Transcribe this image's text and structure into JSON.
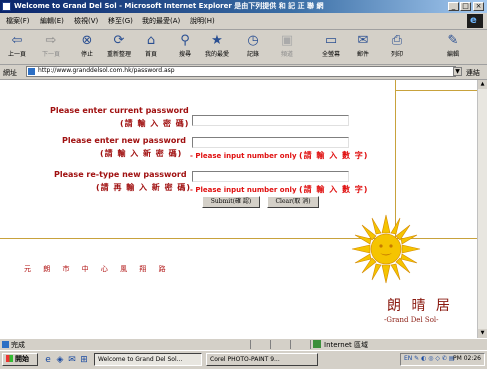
{
  "window": {
    "title": "Welcome to Grand Del Sol - Microsoft Internet Explorer 是由下列提供 和 記 正 聯 網",
    "controls": [
      "_",
      "□",
      "×"
    ]
  },
  "menu": [
    "檔案(F)",
    "編輯(E)",
    "檢視(V)",
    "移至(G)",
    "我的最愛(A)",
    "說明(H)"
  ],
  "toolbar": [
    {
      "label": "上一頁",
      "icon": "back-arrow-icon",
      "glyph": "⇦"
    },
    {
      "label": "下一頁",
      "icon": "forward-arrow-icon",
      "glyph": "⇨"
    },
    {
      "label": "停止",
      "icon": "stop-icon",
      "glyph": "⊗"
    },
    {
      "label": "重新整理",
      "icon": "refresh-icon",
      "glyph": "⟳"
    },
    {
      "label": "首頁",
      "icon": "home-icon",
      "glyph": "⌂"
    },
    {
      "label": "搜尋",
      "icon": "search-icon",
      "glyph": "⚲"
    },
    {
      "label": "我的最愛",
      "icon": "favorites-icon",
      "glyph": "★"
    },
    {
      "label": "記錄",
      "icon": "history-icon",
      "glyph": "◷"
    },
    {
      "label": "頻道",
      "icon": "channels-icon",
      "glyph": "▣"
    },
    {
      "label": "全螢幕",
      "icon": "fullscreen-icon",
      "glyph": "▭"
    },
    {
      "label": "郵件",
      "icon": "mail-icon",
      "glyph": "✉"
    },
    {
      "label": "列印",
      "icon": "print-icon",
      "glyph": "⎙"
    },
    {
      "label": "編輯",
      "icon": "edit-icon",
      "glyph": "✎"
    }
  ],
  "address": {
    "label": "網址",
    "url": "http://www.granddelsol.com.hk/password.asp",
    "go": "連結"
  },
  "form": {
    "current_label": "Please enter current password",
    "current_label_zh": "(請 輸 入 密 碼)",
    "new_label": "Please enter new password",
    "new_label_zh": "(請 輸 入 新 密 碼)",
    "new_note": "Please input number only",
    "new_note_zh": "(請 輸 入 數 字)",
    "retype_label": "Please re-type new password",
    "retype_label_zh": "(請 再 輸 入 新 密 碼)",
    "retype_note": "Please input number only",
    "retype_note_zh": "(請 輸 入 數 字)",
    "submit": "Submit(確 認)",
    "clear": "Clear(取 消)",
    "note_prefix": "-"
  },
  "footer": {
    "links": "元 朗 市 中 心 風 翔 路"
  },
  "brand": {
    "name_zh": "朗 晴 居",
    "name_en": "-Grand Del Sol-"
  },
  "status": {
    "text": "完成",
    "zone": "Internet 區域"
  },
  "taskbar": {
    "start": "開始",
    "quicklaunch": [
      "e",
      "◈",
      "✉",
      "⊞"
    ],
    "tasks": [
      "Welcome to Grand Del Sol...",
      "Corel PHOTO-PAINT 9..."
    ],
    "clock": "PM 02:26",
    "tray_icons": "EN ✎ ◐ ◎ ◇ ✆ ▤"
  },
  "colors": {
    "accent_gold": "#c8a23c",
    "label_red": "#a01010",
    "note_red": "#e01010"
  }
}
